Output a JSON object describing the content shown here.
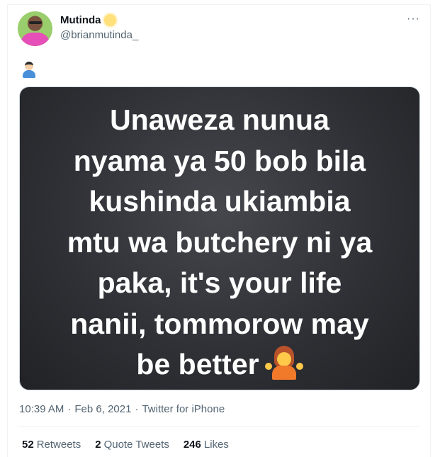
{
  "author": {
    "name": "Mutinda",
    "handle": "@brianmutinda_",
    "name_emoji_icon": "sun-face-icon"
  },
  "more_icon": "ellipsis-icon",
  "more_label": "···",
  "tweet": {
    "emoji_icon": "man-technologist-icon",
    "media_lines": [
      "Unaweza nunua",
      "nyama ya 50 bob bila",
      "kushinda ukiambia",
      "mtu wa butchery ni ya",
      "paka, it's your life",
      "nanii, tommorow may",
      "be better"
    ],
    "media_emoji_icon": "person-shrugging-icon"
  },
  "meta": {
    "time": "10:39 AM",
    "separator": "·",
    "date": "Feb 6, 2021",
    "source": "Twitter for iPhone"
  },
  "stats": {
    "retweets_count": "52",
    "retweets_label": "Retweets",
    "quotes_count": "2",
    "quotes_label": "Quote Tweets",
    "likes_count": "246",
    "likes_label": "Likes"
  },
  "colors": {
    "text_primary": "#0f1419",
    "text_secondary": "#536471",
    "media_background": "#2e2f34",
    "divider": "#eff3f4"
  }
}
